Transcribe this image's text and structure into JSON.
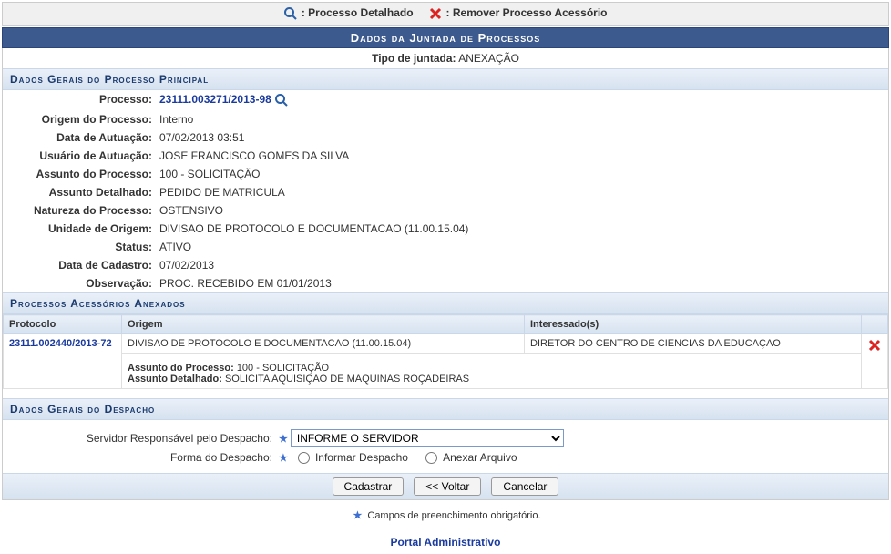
{
  "legend": {
    "detail_label": ": Processo Detalhado",
    "remove_label": ": Remover Processo Acessório"
  },
  "header_title": "Dados da Juntada de Processos",
  "tipo_juntada_label": "Tipo de juntada:",
  "tipo_juntada_value": "ANEXAÇÃO",
  "section_principal_title": "Dados Gerais do Processo Principal",
  "principal": {
    "processo_label": "Processo:",
    "processo_value": "23111.003271/2013-98",
    "origem_label": "Origem do Processo:",
    "origem_value": "Interno",
    "data_autuacao_label": "Data de Autuação:",
    "data_autuacao_value": "07/02/2013 03:51",
    "usuario_autuacao_label": "Usuário de Autuação:",
    "usuario_autuacao_value": "JOSE FRANCISCO GOMES DA SILVA",
    "assunto_label": "Assunto do Processo:",
    "assunto_value": "100 - SOLICITAÇÃO",
    "assunto_det_label": "Assunto Detalhado:",
    "assunto_det_value": "PEDIDO DE MATRICULA",
    "natureza_label": "Natureza do Processo:",
    "natureza_value": "OSTENSIVO",
    "unidade_label": "Unidade de Origem:",
    "unidade_value": "DIVISAO DE PROTOCOLO E DOCUMENTACAO (11.00.15.04)",
    "status_label": "Status:",
    "status_value": "ATIVO",
    "data_cadastro_label": "Data de Cadastro:",
    "data_cadastro_value": "07/02/2013",
    "observacao_label": "Observação:",
    "observacao_value": "PROC. RECEBIDO EM 01/01/2013"
  },
  "section_acessorios_title": "Processos Acessórios Anexados",
  "acc_headers": {
    "protocolo": "Protocolo",
    "origem": "Origem",
    "interessado": "Interessado(s)"
  },
  "acessorios": [
    {
      "protocolo": "23111.002440/2013-72",
      "origem": "DIVISAO DE PROTOCOLO E DOCUMENTACAO (11.00.15.04)",
      "interessado": "DIRETOR DO CENTRO DE CIENCIAS DA EDUCAÇAO",
      "assunto_label": "Assunto do Processo:",
      "assunto_value": "100 - SOLICITAÇÃO",
      "assunto_det_label": "Assunto Detalhado:",
      "assunto_det_value": "SOLICITA AQUISIÇAO DE MAQUINAS ROÇADEIRAS"
    }
  ],
  "section_despacho_title": "Dados Gerais do Despacho",
  "despacho": {
    "servidor_label": "Servidor Responsável pelo Despacho:",
    "servidor_selected": "INFORME O SERVIDOR",
    "forma_label": "Forma do Despacho:",
    "radio_informar": "Informar Despacho",
    "radio_anexar": "Anexar Arquivo"
  },
  "buttons": {
    "cadastrar": "Cadastrar",
    "voltar": "<< Voltar",
    "cancelar": "Cancelar"
  },
  "footnote": "Campos de preenchimento obrigatório.",
  "footer_link": "Portal Administrativo"
}
